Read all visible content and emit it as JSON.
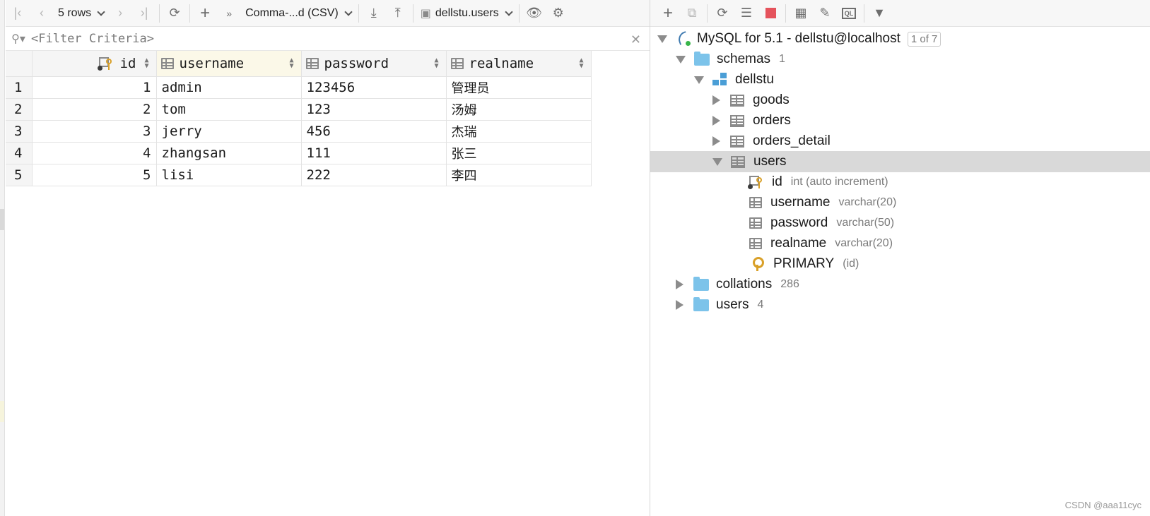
{
  "toolbar": {
    "rows_label": "5 rows",
    "export_format": "Comma-...d (CSV)",
    "table_ref": "dellstu.users"
  },
  "filter": {
    "placeholder": "<Filter Criteria>"
  },
  "grid": {
    "columns": [
      "id",
      "username",
      "password",
      "realname"
    ],
    "rows": [
      {
        "num": "1",
        "id": "1",
        "username": "admin",
        "password": "123456",
        "realname": "管理员"
      },
      {
        "num": "2",
        "id": "2",
        "username": "tom",
        "password": "123",
        "realname": "汤姆"
      },
      {
        "num": "3",
        "id": "3",
        "username": "jerry",
        "password": "456",
        "realname": "杰瑞"
      },
      {
        "num": "4",
        "id": "4",
        "username": "zhangsan",
        "password": "111",
        "realname": "张三"
      },
      {
        "num": "5",
        "id": "5",
        "username": "lisi",
        "password": "222",
        "realname": "李四"
      }
    ]
  },
  "tree": {
    "connection": "MySQL for 5.1 - dellstu@localhost",
    "connection_badge": "1 of 7",
    "schemas": {
      "label": "schemas",
      "count": "1"
    },
    "schema_name": "dellstu",
    "tables": [
      "goods",
      "orders",
      "orders_detail",
      "users"
    ],
    "columns": [
      {
        "name": "id",
        "type": "int (auto increment)"
      },
      {
        "name": "username",
        "type": "varchar(20)"
      },
      {
        "name": "password",
        "type": "varchar(50)"
      },
      {
        "name": "realname",
        "type": "varchar(20)"
      }
    ],
    "key": {
      "name": "PRIMARY",
      "cols": "(id)"
    },
    "collations": {
      "label": "collations",
      "count": "286"
    },
    "users_folder": {
      "label": "users",
      "count": "4"
    }
  },
  "watermark": "CSDN @aaa11cyc"
}
